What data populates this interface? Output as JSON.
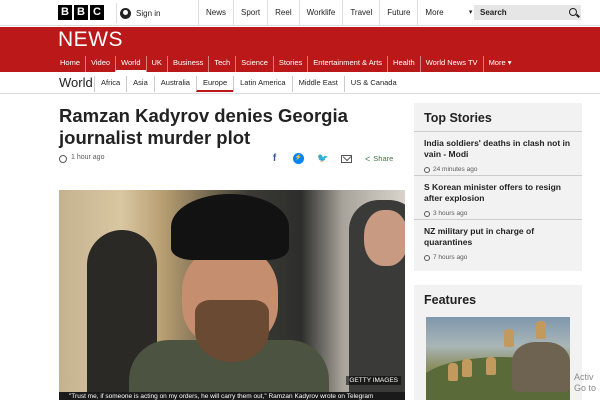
{
  "topbar": {
    "logo_letters": [
      "B",
      "B",
      "C"
    ],
    "signin_label": "Sign in",
    "nav": [
      "News",
      "Sport",
      "Reel",
      "Worklife",
      "Travel",
      "Future",
      "More"
    ],
    "search_placeholder": "Search"
  },
  "newsband": {
    "logo": "NEWS",
    "nav": [
      "Home",
      "Video",
      "World",
      "UK",
      "Business",
      "Tech",
      "Science",
      "Stories",
      "Entertainment & Arts",
      "Health",
      "World News TV",
      "More"
    ],
    "active": "World"
  },
  "section": {
    "title": "World",
    "subnav": [
      "Africa",
      "Asia",
      "Australia",
      "Europe",
      "Latin America",
      "Middle East",
      "US & Canada"
    ],
    "active": "Europe"
  },
  "article": {
    "headline": "Ramzan Kadyrov denies Georgia journalist murder plot",
    "timestamp": "1 hour ago",
    "share_label": "Share",
    "image_credit": "GETTY IMAGES",
    "caption": "\"Trust me, if someone is acting on my orders, he will carry them out,\" Ramzan Kadyrov wrote on Telegram"
  },
  "top_stories": {
    "title": "Top Stories",
    "items": [
      {
        "title": "India soldiers' deaths in clash not in vain - Modi",
        "time": "24 minutes ago"
      },
      {
        "title": "S Korean minister offers to resign after explosion",
        "time": "3 hours ago"
      },
      {
        "title": "NZ military put in charge of quarantines",
        "time": "7 hours ago"
      }
    ]
  },
  "features": {
    "title": "Features"
  },
  "watermark": {
    "line1": "Activ",
    "line2": "Go to"
  },
  "colors": {
    "brand_red": "#bb1919",
    "panel_bg": "#f2f2f2",
    "share_green": "#3a7b47"
  }
}
